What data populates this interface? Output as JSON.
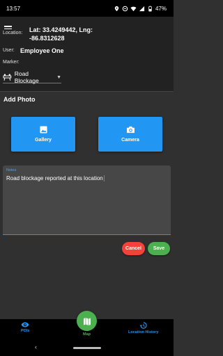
{
  "status": {
    "time": "13:57",
    "battery": "47%"
  },
  "form": {
    "location_label": "Location:",
    "location_value": "Lat: 33.4249442, Lng: -86.8312628",
    "user_label": "User:",
    "user_value": "Employee One",
    "marker_label": "Marker:",
    "marker_selected": "Road Blockage"
  },
  "photo": {
    "heading": "Add Photo",
    "gallery_label": "Gallery",
    "camera_label": "Camera"
  },
  "notes": {
    "label": "Notes",
    "value": "Road blockage reported at this location"
  },
  "actions": {
    "cancel": "Cancel",
    "save": "Save"
  },
  "nav": {
    "pois": "POIs",
    "map": "Map",
    "history": "Location History"
  },
  "colors": {
    "accent": "#2196f3",
    "cancel": "#f44336",
    "save": "#4caf50"
  }
}
